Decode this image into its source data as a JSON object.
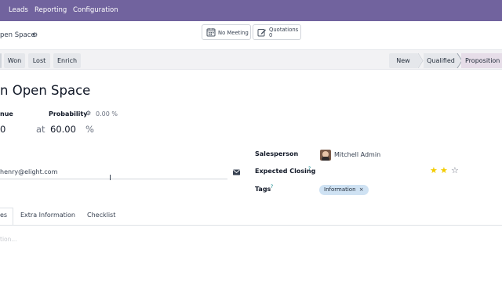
{
  "nav": {
    "leads": "Leads",
    "reporting": "Reporting",
    "configuration": "Configuration"
  },
  "breadcrumb": {
    "title": "pen Space"
  },
  "smart_buttons": {
    "meeting": "No Meeting",
    "quotations_label": "Quotations",
    "quotations_count": "0"
  },
  "actions": {
    "won": "Won",
    "lost": "Lost",
    "enrich": "Enrich"
  },
  "stages": {
    "new": "New",
    "qualified": "Qualified",
    "proposition": "Proposition",
    "current": "Proposition"
  },
  "lead": {
    "title": "n Open Space",
    "revenue_label": "nue",
    "revenue_value": "0",
    "at_label": "at",
    "probability_label": "Probability",
    "probability_auto": "0.00 %",
    "probability_value": "60.00",
    "percent_sign": "%",
    "email": "henry@elight.com"
  },
  "right": {
    "salesperson_label": "Salesperson",
    "salesperson_value": "Mitchell Admin",
    "expected_closing_label": "Expected Closing",
    "help_mark": "?",
    "tags_label": "Tags",
    "tag_information": "Information",
    "priority_stars_filled": 2,
    "priority_stars_total": 3
  },
  "tabs": {
    "notes": "es",
    "extra": "Extra Information",
    "checklist": "Checklist"
  },
  "notes_placeholder": "tion...",
  "colors": {
    "topbar": "#71639e",
    "tag_bg": "#cfe2f3",
    "star": "#f3cc00",
    "accent": "#714b67"
  }
}
